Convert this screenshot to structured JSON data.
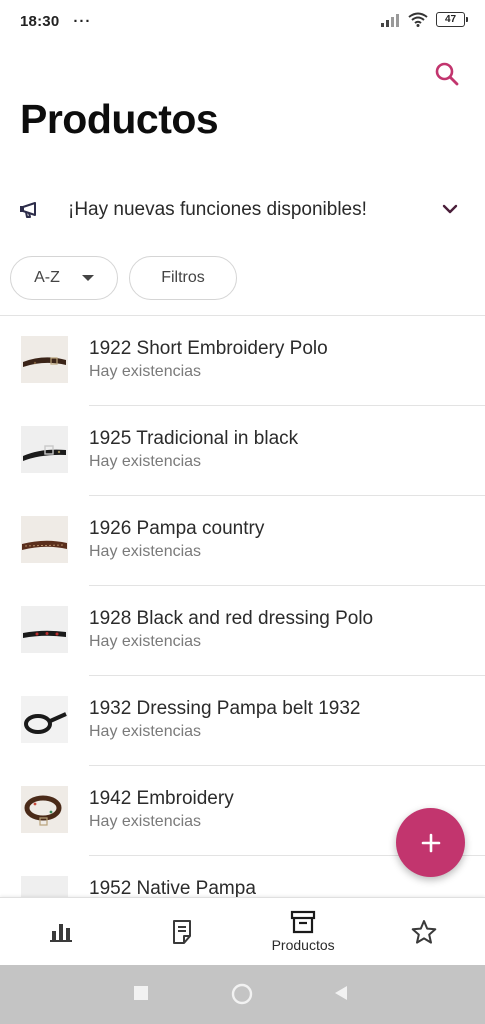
{
  "status_bar": {
    "time": "18:30",
    "dots": "···",
    "battery": "47"
  },
  "header": {
    "title": "Productos",
    "search_icon": "search-icon"
  },
  "banner": {
    "icon": "megaphone-icon",
    "text": "¡Hay nuevas funciones disponibles!",
    "chevron": "chevron-down-icon"
  },
  "filters": {
    "sort_label": "A-Z",
    "filter_label": "Filtros"
  },
  "products": [
    {
      "name": "1922 Short Embroidery Polo",
      "stock": "Hay existencias"
    },
    {
      "name": "1925 Tradicional in black",
      "stock": "Hay existencias"
    },
    {
      "name": "1926 Pampa country",
      "stock": "Hay existencias"
    },
    {
      "name": "1928 Black and red dressing Polo",
      "stock": "Hay existencias"
    },
    {
      "name": "1932 Dressing Pampa belt 1932",
      "stock": "Hay existencias"
    },
    {
      "name": "1942 Embroidery",
      "stock": "Hay existencias"
    },
    {
      "name": "1952 Native Pampa",
      "stock": ""
    }
  ],
  "fab": {
    "icon": "plus-icon"
  },
  "bottom_nav": {
    "items": [
      {
        "icon": "bar-chart-icon",
        "label": ""
      },
      {
        "icon": "document-icon",
        "label": ""
      },
      {
        "icon": "archive-box-icon",
        "label": "Productos"
      },
      {
        "icon": "star-icon",
        "label": ""
      }
    ]
  },
  "colors": {
    "accent": "#c2356e",
    "text_primary": "#2b2b2b",
    "text_secondary": "#7a7a7a"
  }
}
